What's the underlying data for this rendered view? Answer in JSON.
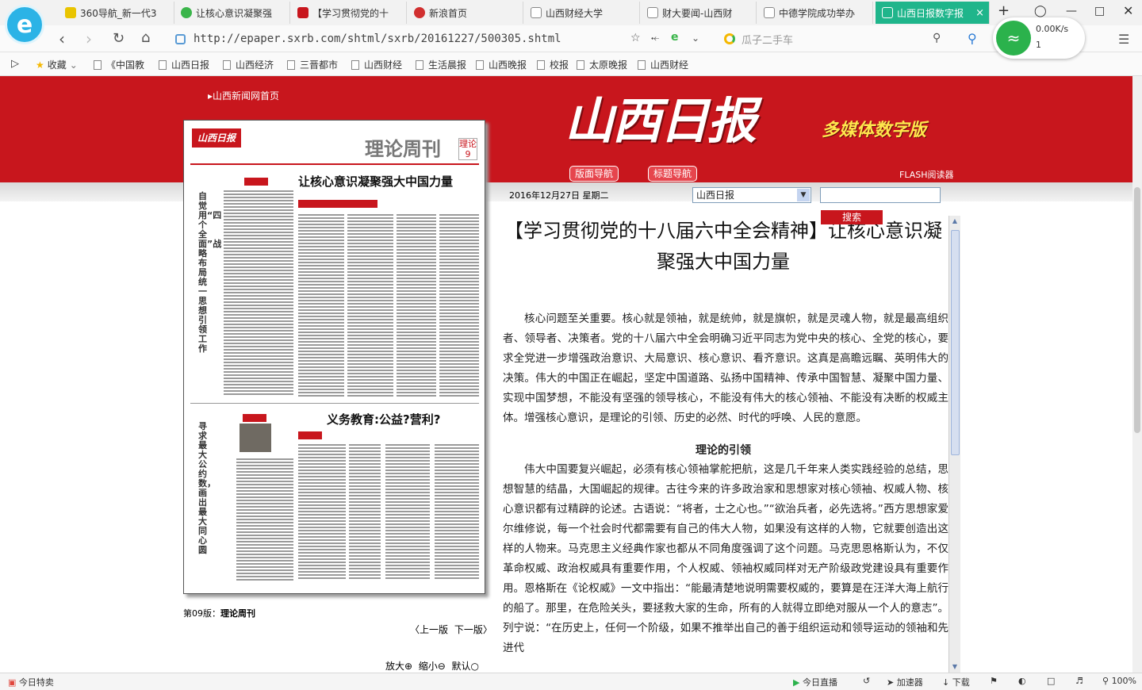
{
  "browser": {
    "tabs": [
      {
        "label": "360导航_新一代3",
        "color": "#e9c400"
      },
      {
        "label": "让核心意识凝聚强",
        "color": "#3ab54a"
      },
      {
        "label": "【学习贯彻党的十",
        "color": "#c8161d"
      },
      {
        "label": "新浪首页",
        "color": "#d12f2f"
      },
      {
        "label": "山西财经大学",
        "color": "#888888"
      },
      {
        "label": "财大要闻-山西财",
        "color": "#888888"
      },
      {
        "label": "中德学院成功举办",
        "color": "#888888"
      },
      {
        "label": "山西日报数字报",
        "color": "#ffffff"
      }
    ],
    "active_tab_close": "×",
    "new_tab": "+",
    "url": "http://epaper.sxrb.com/shtml/sxrb/20161227/500305.shtml",
    "search_placeholder": "瓜子二手车",
    "network": {
      "speed": "0.00K/s",
      "count": "1"
    },
    "bookmarks": [
      "收藏",
      "《中国教",
      "山西日报",
      "山西经济",
      "三晋都市",
      "山西财经",
      "生活晨报",
      "山西晚报",
      "校报",
      "太原晚报",
      "山西财经"
    ],
    "status": {
      "left": "今日特卖",
      "live": "今日直播",
      "accelerator": "加速器",
      "download": "下载",
      "zoom": "100%"
    },
    "accent": "#1fb58b"
  },
  "site": {
    "home_link": "山西新闻网首页",
    "masthead": "山西日报",
    "subtitle": "多媒体数字版",
    "nav_layout": "版面导航",
    "nav_titles": "标题导航",
    "flash_reader": "FLASH阅读器",
    "date": "2016年12月27日  星期二",
    "paper_select": "山西日报",
    "search_button": "搜索",
    "brand_red": "#c8161d"
  },
  "page_thumb": {
    "masthead": "山西日报",
    "section_title": "理论周刊",
    "page_number": "理论 9",
    "headline_top": "让核心意识凝聚强大中国力量",
    "headline_bottom": "义务教育:公益?营利?",
    "vertical_top": "自觉用“四个全面”战略布局统一思想引领工作",
    "vertical_bottom": "寻求最大公约数，画出最大同心圆",
    "caption_page": "第09版：",
    "caption_title": "理论周刊"
  },
  "pager": {
    "prev": "〈上一版",
    "next": "下一版〉",
    "zoom_in": "放大",
    "zoom_out": "缩小",
    "default": "默认"
  },
  "article": {
    "title": "【学习贯彻党的十八届六中全会精神】让核心意识凝聚强大中国力量",
    "para1": "核心问题至关重要。核心就是领袖，就是统帅，就是旗帜，就是灵魂人物，就是最高组织者、领导者、决策者。党的十八届六中全会明确习近平同志为党中央的核心、全党的核心，要求全党进一步增强政治意识、大局意识、核心意识、看齐意识。这真是高瞻远瞩、英明伟大的决策。伟大的中国正在崛起，坚定中国道路、弘扬中国精神、传承中国智慧、凝聚中国力量、实现中国梦想，不能没有坚强的领导核心，不能没有伟大的核心领袖、不能没有决断的权威主体。增强核心意识，是理论的引领、历史的必然、时代的呼唤、人民的意愿。",
    "section1": "理论的引领",
    "para2": "伟大中国要复兴崛起，必须有核心领袖掌舵把航，这是几千年来人类实践经验的总结，思想智慧的结晶，大国崛起的规律。古往今来的许多政治家和思想家对核心领袖、权威人物、核心意识都有过精辟的论述。古语说：“将者，士之心也。”“欲治兵者，必先选将。”西方思想家爱尔维修说，每一个社会时代都需要有自己的伟大人物，如果没有这样的人物，它就要创造出这样的人物来。马克思主义经典作家也都从不同角度强调了这个问题。马克思恩格斯认为，不仅革命权威、政治权威具有重要作用，个人权威、领袖权威同样对无产阶级政党建设具有重要作用。恩格斯在《论权威》一文中指出：“能最清楚地说明需要权威的，要算是在汪洋大海上航行的船了。那里，在危险关头，要拯救大家的生命，所有的人就得立即绝对服从一个人的意志”。列宁说：“在历史上，任何一个阶级，如果不推举出自己的善于组织运动和领导运动的领袖和先进代"
  }
}
